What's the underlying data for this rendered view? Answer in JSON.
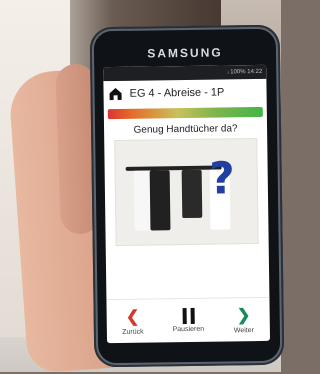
{
  "phone": {
    "brand": "SAMSUNG",
    "status": "ᵢ 100% 14:22"
  },
  "app": {
    "header_title": "EG 4 - Abreise - 1P",
    "question": "Genug Handtücher da?",
    "buttons": {
      "back": "Zurück",
      "pause": "Pausieren",
      "next": "Weiter"
    },
    "icons": {
      "home": "home-icon",
      "back": "chevron-left-icon",
      "pause": "pause-icon",
      "next": "chevron-right-icon"
    },
    "colors": {
      "back_icon": "#d23a2e",
      "next_icon": "#1a8b5b",
      "progress_start": "#dd3333",
      "progress_end": "#45b548"
    }
  }
}
